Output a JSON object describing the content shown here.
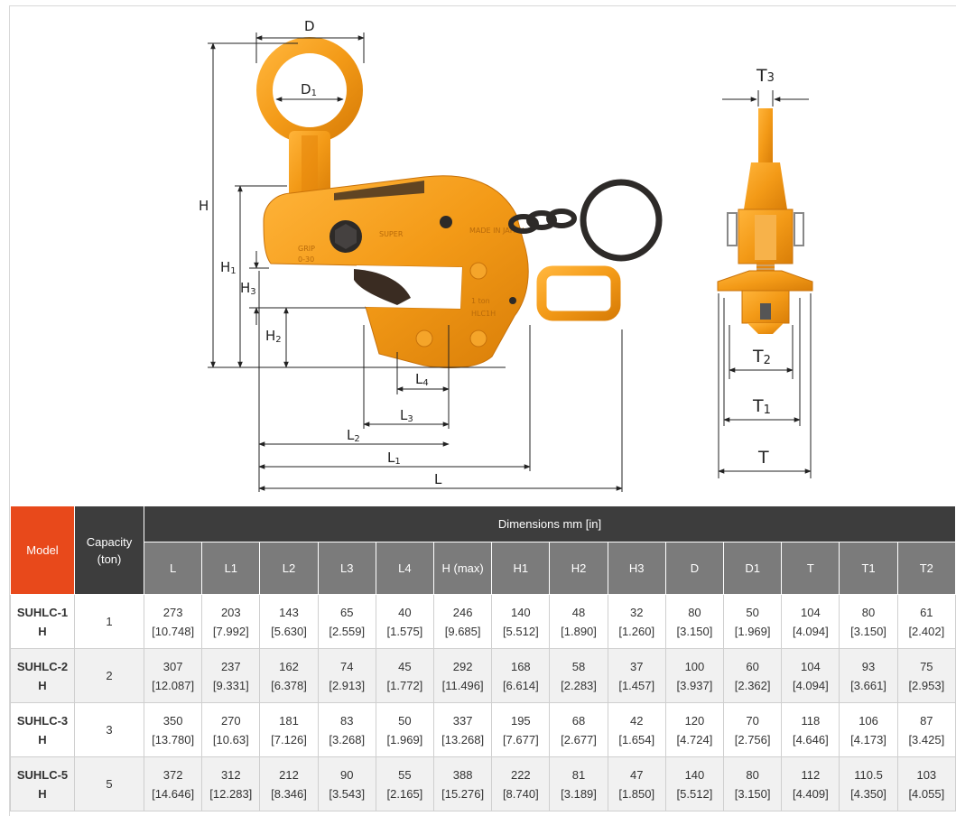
{
  "figure": {
    "stamps": {
      "brand": "SUPER",
      "made_in": "MADE IN JAPAN",
      "grip": "GRIP",
      "grip_range": "0-30",
      "rating": "1 ton",
      "model_mark": "HLC1H"
    }
  },
  "table": {
    "model_header": "Model",
    "capacity_header": "Capacity (ton)",
    "dimensions_header": "Dimensions mm [in]",
    "columns": [
      "L",
      "L1",
      "L2",
      "L3",
      "L4",
      "H (max)",
      "H1",
      "H2",
      "H3",
      "D",
      "D1",
      "T",
      "T1",
      "T2"
    ],
    "rows": [
      {
        "model": "SUHLC-1H",
        "capacity": "1",
        "values": [
          [
            "273",
            "[10.748]"
          ],
          [
            "203",
            "[7.992]"
          ],
          [
            "143",
            "[5.630]"
          ],
          [
            "65",
            "[2.559]"
          ],
          [
            "40",
            "[1.575]"
          ],
          [
            "246",
            "[9.685]"
          ],
          [
            "140",
            "[5.512]"
          ],
          [
            "48",
            "[1.890]"
          ],
          [
            "32",
            "[1.260]"
          ],
          [
            "80",
            "[3.150]"
          ],
          [
            "50",
            "[1.969]"
          ],
          [
            "104",
            "[4.094]"
          ],
          [
            "80",
            "[3.150]"
          ],
          [
            "61",
            "[2.402]"
          ]
        ]
      },
      {
        "model": "SUHLC-2H",
        "capacity": "2",
        "values": [
          [
            "307",
            "[12.087]"
          ],
          [
            "237",
            "[9.331]"
          ],
          [
            "162",
            "[6.378]"
          ],
          [
            "74",
            "[2.913]"
          ],
          [
            "45",
            "[1.772]"
          ],
          [
            "292",
            "[11.496]"
          ],
          [
            "168",
            "[6.614]"
          ],
          [
            "58",
            "[2.283]"
          ],
          [
            "37",
            "[1.457]"
          ],
          [
            "100",
            "[3.937]"
          ],
          [
            "60",
            "[2.362]"
          ],
          [
            "104",
            "[4.094]"
          ],
          [
            "93",
            "[3.661]"
          ],
          [
            "75",
            "[2.953]"
          ]
        ]
      },
      {
        "model": "SUHLC-3H",
        "capacity": "3",
        "values": [
          [
            "350",
            "[13.780]"
          ],
          [
            "270",
            "[10.63]"
          ],
          [
            "181",
            "[7.126]"
          ],
          [
            "83",
            "[3.268]"
          ],
          [
            "50",
            "[1.969]"
          ],
          [
            "337",
            "[13.268]"
          ],
          [
            "195",
            "[7.677]"
          ],
          [
            "68",
            "[2.677]"
          ],
          [
            "42",
            "[1.654]"
          ],
          [
            "120",
            "[4.724]"
          ],
          [
            "70",
            "[2.756]"
          ],
          [
            "118",
            "[4.646]"
          ],
          [
            "106",
            "[4.173]"
          ],
          [
            "87",
            "[3.425]"
          ]
        ]
      },
      {
        "model": "SUHLC-5H",
        "capacity": "5",
        "values": [
          [
            "372",
            "[14.646]"
          ],
          [
            "312",
            "[12.283]"
          ],
          [
            "212",
            "[8.346]"
          ],
          [
            "90",
            "[3.543]"
          ],
          [
            "55",
            "[2.165]"
          ],
          [
            "388",
            "[15.276]"
          ],
          [
            "222",
            "[8.740]"
          ],
          [
            "81",
            "[3.189]"
          ],
          [
            "47",
            "[1.850]"
          ],
          [
            "140",
            "[5.512]"
          ],
          [
            "80",
            "[3.150]"
          ],
          [
            "112",
            "[4.409]"
          ],
          [
            "110.5",
            "[4.350]"
          ],
          [
            "103",
            "[4.055]"
          ]
        ]
      }
    ]
  }
}
